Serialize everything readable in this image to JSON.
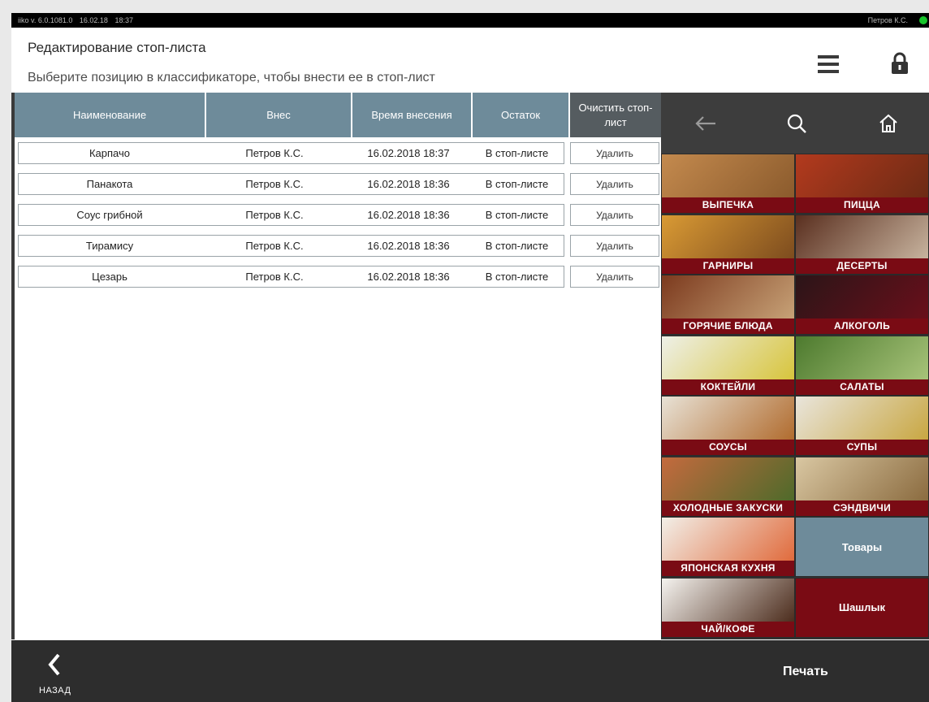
{
  "statusbar": {
    "version": "iiko v. 6.0.1081.0",
    "date": "16.02.18",
    "time": "18:37",
    "user": "Петров К.С."
  },
  "header": {
    "title": "Редактирование стоп-листа",
    "subtitle": "Выберите позицию в классификаторе, чтобы внести ее в стоп-лист"
  },
  "table": {
    "columns": [
      "Наименование",
      "Внес",
      "Время внесения",
      "Остаток",
      "Очистить стоп-лист"
    ],
    "rows": [
      {
        "name": "Карпачо",
        "by": "Петров К.С.",
        "time": "16.02.2018 18:37",
        "rest": "В стоп-листе",
        "action": "Удалить"
      },
      {
        "name": "Панакота",
        "by": "Петров К.С.",
        "time": "16.02.2018 18:36",
        "rest": "В стоп-листе",
        "action": "Удалить"
      },
      {
        "name": "Соус грибной",
        "by": "Петров К.С.",
        "time": "16.02.2018 18:36",
        "rest": "В стоп-листе",
        "action": "Удалить"
      },
      {
        "name": "Тирамису",
        "by": "Петров К.С.",
        "time": "16.02.2018 18:36",
        "rest": "В стоп-листе",
        "action": "Удалить"
      },
      {
        "name": "Цезарь",
        "by": "Петров К.С.",
        "time": "16.02.2018 18:36",
        "rest": "В стоп-листе",
        "action": "Удалить"
      }
    ]
  },
  "categories": [
    {
      "label": "ВЫПЕЧКА",
      "icon": "pastry-image",
      "colors": [
        "#c48a4e",
        "#8a5a2c"
      ]
    },
    {
      "label": "ПИЦЦА",
      "icon": "pizza-image",
      "colors": [
        "#b33a1e",
        "#6b2a14"
      ]
    },
    {
      "label": "ГАРНИРЫ",
      "icon": "potatoes-image",
      "colors": [
        "#d99a34",
        "#7c4b1e"
      ]
    },
    {
      "label": "ДЕСЕРТЫ",
      "icon": "dessert-image",
      "colors": [
        "#5a2f1f",
        "#c9b5a0"
      ]
    },
    {
      "label": "ГОРЯЧИЕ БЛЮДА",
      "icon": "steak-image",
      "colors": [
        "#7c3a1e",
        "#c8a378"
      ]
    },
    {
      "label": "АЛКОГОЛЬ",
      "icon": "wine-image",
      "colors": [
        "#2b1518",
        "#6a0f1a"
      ]
    },
    {
      "label": "КОКТЕЙЛИ",
      "icon": "cocktails-image",
      "colors": [
        "#eef0e8",
        "#d7c43a"
      ]
    },
    {
      "label": "САЛАТЫ",
      "icon": "salad-image",
      "colors": [
        "#4d7a2e",
        "#a8c47a"
      ]
    },
    {
      "label": "СОУСЫ",
      "icon": "sauces-image",
      "colors": [
        "#e8e2d6",
        "#b06a2c"
      ]
    },
    {
      "label": "СУПЫ",
      "icon": "soup-image",
      "colors": [
        "#e9e5dc",
        "#c8a640"
      ]
    },
    {
      "label": "ХОЛОДНЫЕ ЗАКУСКИ",
      "icon": "appetizers-image",
      "colors": [
        "#c46a3e",
        "#4d6a2a"
      ]
    },
    {
      "label": "СЭНДВИЧИ",
      "icon": "sandwich-image",
      "colors": [
        "#d9c7a2",
        "#8a6a3e"
      ]
    },
    {
      "label": "ЯПОНСКАЯ КУХНЯ",
      "icon": "sushi-image",
      "colors": [
        "#f2efe8",
        "#e0693a"
      ]
    },
    {
      "label": "Товары",
      "icon": "",
      "colors": [
        "#6e8b9a",
        "#6e8b9a"
      ]
    },
    {
      "label": "ЧАЙ/КОФЕ",
      "icon": "coffee-image",
      "colors": [
        "#f5f3ef",
        "#4a2a1a"
      ]
    },
    {
      "label": "Шашлык",
      "icon": "",
      "colors": [
        "#7a0b14",
        "#7a0b14"
      ]
    }
  ],
  "bottombar": {
    "back_label": "НАЗАД",
    "print_label": "Печать"
  },
  "colors": {
    "header_col": "#6e8b9a",
    "category_label": "#7a0b14",
    "status_online": "#18c52b"
  }
}
